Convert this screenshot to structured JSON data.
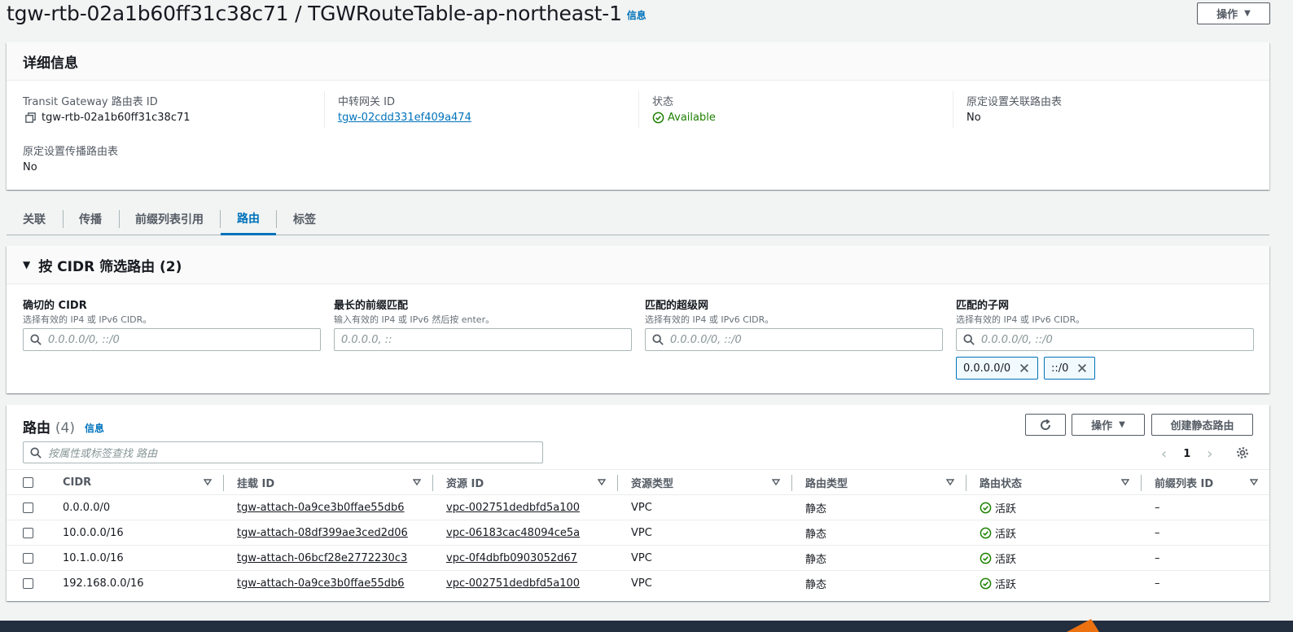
{
  "header": {
    "title": "tgw-rtb-02a1b60ff31c38c71 / TGWRouteTable-ap-northeast-1",
    "info": "信息",
    "actions_label": "操作"
  },
  "details": {
    "title": "详细信息",
    "fields": [
      {
        "label": "Transit Gateway 路由表 ID",
        "value": "tgw-rtb-02a1b60ff31c38c71"
      },
      {
        "label": "中转网关 ID",
        "value": "tgw-02cdd331ef409a474"
      },
      {
        "label": "状态",
        "value": "Available"
      },
      {
        "label": "原定设置关联路由表",
        "value": "No"
      },
      {
        "label": "原定设置传播路由表",
        "value": "No"
      }
    ]
  },
  "tabs": [
    {
      "label": "关联"
    },
    {
      "label": "传播"
    },
    {
      "label": "前缀列表引用"
    },
    {
      "label": "路由",
      "active": true
    },
    {
      "label": "标签"
    }
  ],
  "filter": {
    "title": "按 CIDR 筛选路由 (2)",
    "fields": [
      {
        "label": "确切的 CIDR",
        "desc": "选择有效的 IP4 或 IPv6 CIDR。",
        "placeholder": "0.0.0.0/0, ::/0"
      },
      {
        "label": "最长的前缀匹配",
        "desc": "输入有效的 IP4 或 IPv6 然后按 enter。",
        "placeholder": "0.0.0.0, ::"
      },
      {
        "label": "匹配的超级网",
        "desc": "选择有效的 IP4 或 IPv6 CIDR。",
        "placeholder": "0.0.0.0/0, ::/0"
      },
      {
        "label": "匹配的子网",
        "desc": "选择有效的 IP4 或 IPv6 CIDR。",
        "placeholder": "0.0.0.0/0, ::/0"
      }
    ],
    "tokens": [
      "0.0.0.0/0",
      "::/0"
    ]
  },
  "routes": {
    "title": "路由",
    "count": "(4)",
    "info": "信息",
    "actions_label": "操作",
    "create_label": "创建静态路由",
    "search_placeholder": "按属性或标签查找 路由",
    "page": "1",
    "columns": [
      "CIDR",
      "挂载 ID",
      "资源 ID",
      "资源类型",
      "路由类型",
      "路由状态",
      "前缀列表 ID"
    ],
    "rows": [
      {
        "cidr": "0.0.0.0/0",
        "attach": "tgw-attach-0a9ce3b0ffae55db6",
        "resource": "vpc-002751dedbfd5a100",
        "rtype": "VPC",
        "route_type": "静态",
        "state": "活跃",
        "prefix": "–"
      },
      {
        "cidr": "10.0.0.0/16",
        "attach": "tgw-attach-08df399ae3ced2d06",
        "resource": "vpc-06183cac48094ce5a",
        "rtype": "VPC",
        "route_type": "静态",
        "state": "活跃",
        "prefix": "–"
      },
      {
        "cidr": "10.1.0.0/16",
        "attach": "tgw-attach-06bcf28e2772230c3",
        "resource": "vpc-0f4dbfb0903052d67",
        "rtype": "VPC",
        "route_type": "静态",
        "state": "活跃",
        "prefix": "–"
      },
      {
        "cidr": "192.168.0.0/16",
        "attach": "tgw-attach-0a9ce3b0ffae55db6",
        "resource": "vpc-002751dedbfd5a100",
        "rtype": "VPC",
        "route_type": "静态",
        "state": "活跃",
        "prefix": "–"
      }
    ]
  },
  "colors": {
    "link": "#0073bb",
    "success": "#1d8102",
    "accent": "#ec7211"
  }
}
